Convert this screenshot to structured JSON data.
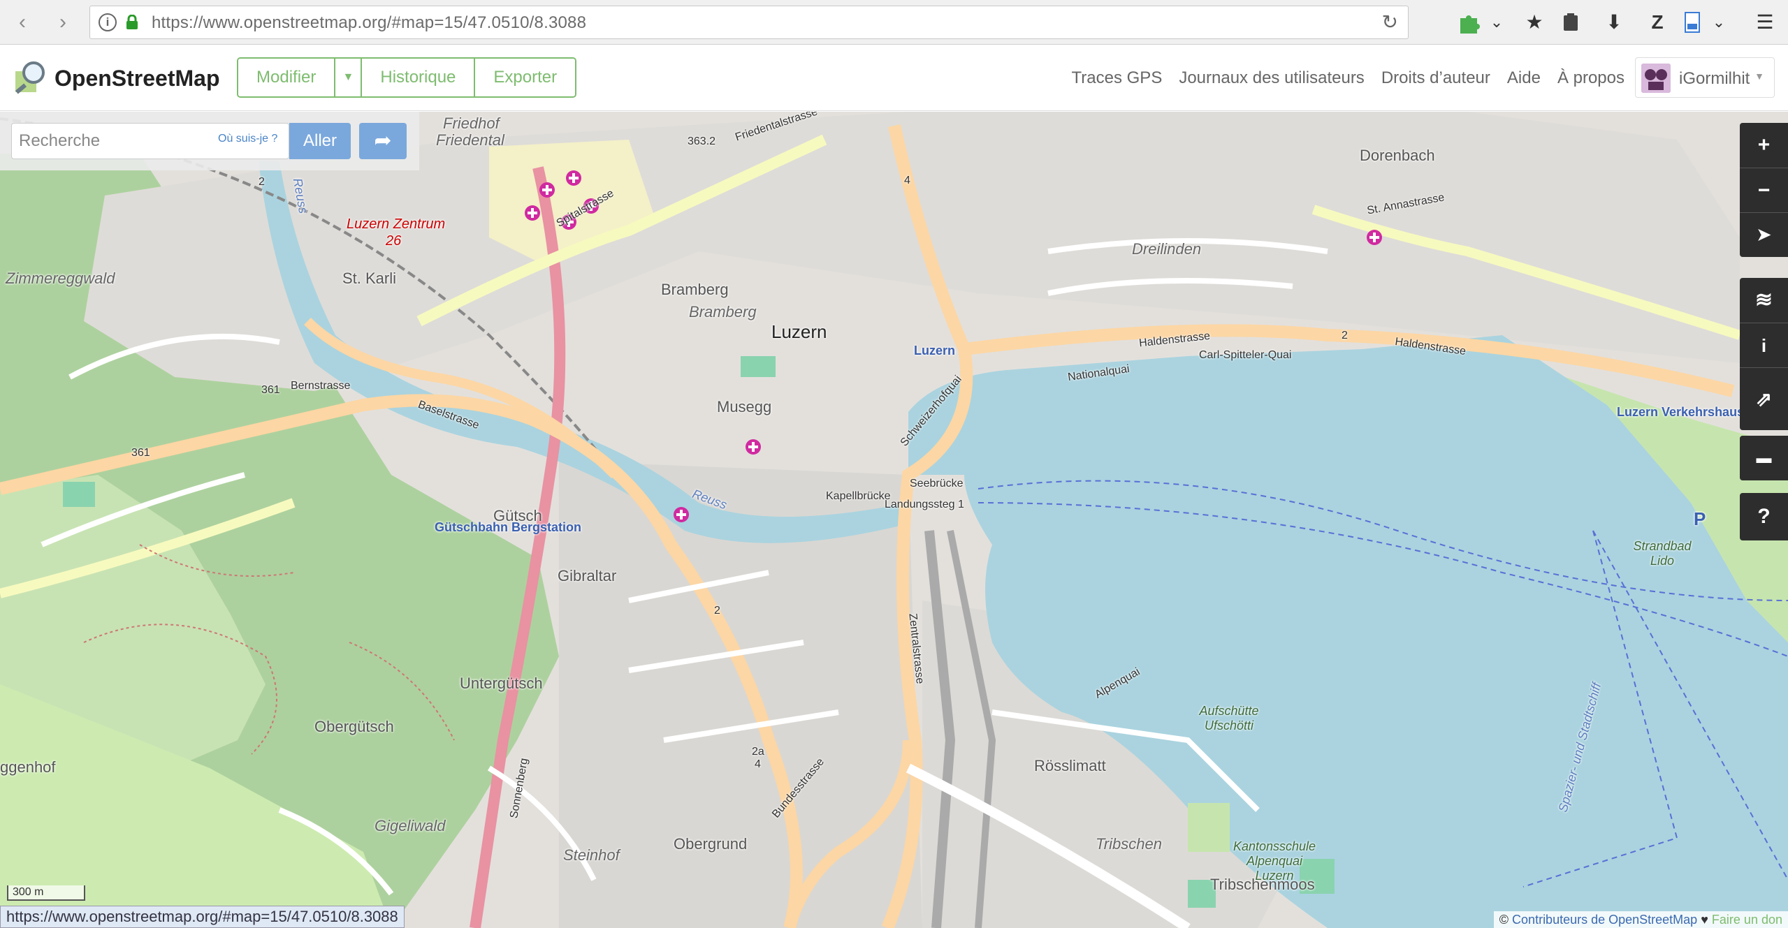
{
  "browser": {
    "back": "‹",
    "forward": "›",
    "url": "https://www.openstreetmap.org/#map=15/47.0510/8.3088",
    "info": "i",
    "reload": "↻"
  },
  "header": {
    "brand": "OpenStreetMap",
    "buttons": {
      "edit": "Modifier",
      "history": "Historique",
      "export": "Exporter"
    },
    "links": [
      "Traces GPS",
      "Journaux des utilisateurs",
      "Droits d’auteur",
      "Aide",
      "À propos"
    ],
    "user": "iGormilhit"
  },
  "search": {
    "placeholder": "Recherche",
    "where_am_i": "Où suis-je ?",
    "go": "Aller"
  },
  "map_labels": {
    "luzern_center": "Luzern",
    "luzern_station": "Luzern",
    "verkehrshaus": "Luzern Verkehrshaus",
    "guetschbahn": "Gütschbahn Bergstation",
    "zentrum": "Luzern Zentrum",
    "zentrum_num": "26",
    "dorenbach": "Dorenbach",
    "dreilinden": "Dreilinden",
    "friedhof": "Friedhof",
    "friedental": "Friedental",
    "st_karli": "St. Karli",
    "zimmereggwald": "Zimmereggwald",
    "bramberg": "Bramberg",
    "bramberg_area": "Bramberg",
    "musegg": "Musegg",
    "guetsch": "Gütsch",
    "gibraltar": "Gibraltar",
    "untergutsch": "Untergütsch",
    "obergutsch": "Obergütsch",
    "obergrund": "Obergrund",
    "steinhof": "Steinhof",
    "gigeliwald": "Gigeliwald",
    "rosslimatt": "Rösslimatt",
    "tribschen": "Tribschen",
    "tribschenmoos": "Tribschenmoos",
    "kantonsschule": "Kantonsschule Alpenquai Luzern",
    "aufschuette": "Aufschütte Ufschötti",
    "strandbad": "Strandbad Lido",
    "ggenhof": "ggenhof",
    "spitalstrasse": "Spitalstrasse",
    "baselstrasse": "Baselstrasse",
    "bernstrasse": "Bernstrasse",
    "haldenstrasse": "Haldenstrasse",
    "haldenstrasse2": "Haldenstrasse",
    "zentralstrasse": "Zentralstrasse",
    "bundesstrasse": "Bundesstrasse",
    "schweizerhofquai": "Schweizerhofquai",
    "st_annastrasse": "St. Annastrasse",
    "friedentalstrasse": "Friedentalstrasse",
    "sonnenberg": "Sonnenberg",
    "landungssteg": "Landungssteg 1",
    "seebruecke": "Seebrücke",
    "kapellbruecke": "Kapellbrücke",
    "reuss": "Reuss",
    "reuss2": "Reuss",
    "ref_363": "363.2",
    "ref_361a": "361",
    "ref_361b": "361",
    "ref_2a": "2",
    "ref_2b": "2",
    "ref_2c": "2",
    "ref_4": "4",
    "ref_2a4": "2a",
    "ref_4b": "4",
    "spazier": "Spazier- und Stadtschiff",
    "parking": "P",
    "carl_spitteler": "Carl-Spitteler-Quai",
    "nationalquai": "Nationalquai",
    "alpenquai": "Alpenquai"
  },
  "controls": {
    "zoom_in": "+",
    "zoom_out": "−",
    "locate": "➤",
    "layers": "≋",
    "info": "i",
    "share": "⇗",
    "note": "▬",
    "help": "?"
  },
  "scale": "300 m",
  "status_url": "https://www.openstreetmap.org/#map=15/47.0510/8.3088",
  "attribution": {
    "copyright": "©",
    "contributors": "Contributeurs de OpenStreetMap",
    "heart": "♥",
    "donate": "Faire un don"
  },
  "colors": {
    "osm_green": "#7ebc6f",
    "lake": "#aad3df",
    "forest": "#add19e",
    "primary_road": "#fcd6a4",
    "secondary_road": "#f7fabf",
    "residential": "#e0dfdf"
  }
}
